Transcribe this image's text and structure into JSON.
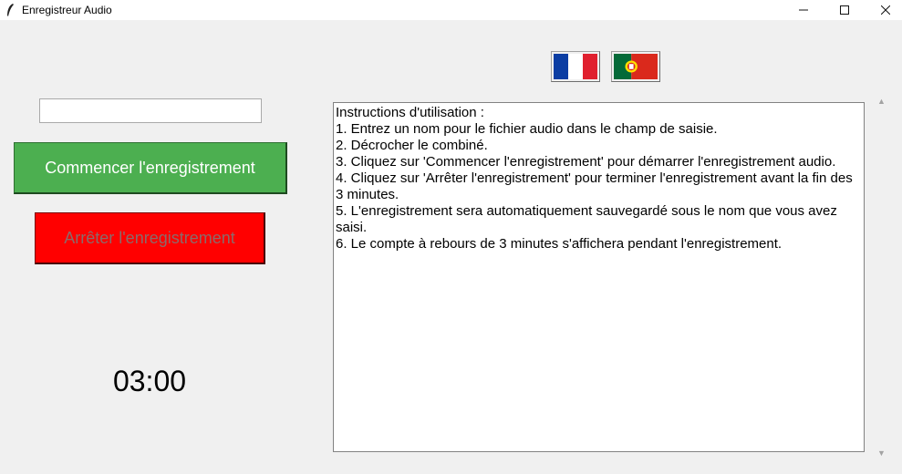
{
  "window": {
    "title": "Enregistreur Audio",
    "controls": {
      "minimize": "—",
      "maximize": "☐",
      "close": "✕"
    }
  },
  "languages": [
    {
      "name": "french-flag",
      "colors": [
        "#0b3da3",
        "#ffffff",
        "#e0202f"
      ]
    },
    {
      "name": "portugal-flag",
      "colors": [
        "#046a38",
        "#da291c",
        "#ffe100"
      ]
    }
  ],
  "form": {
    "filename_value": "",
    "filename_placeholder": ""
  },
  "buttons": {
    "start_label": "Commencer l'enregistrement",
    "stop_label": "Arrêter l'enregistrement"
  },
  "timer": "03:00",
  "instructions": [
    "Instructions d'utilisation :",
    "1. Entrez un nom pour le fichier audio dans le champ de saisie.",
    "2. Décrocher le combiné.",
    "3. Cliquez sur 'Commencer l'enregistrement' pour démarrer l'enregistrement audio.",
    "4. Cliquez sur 'Arrêter l'enregistrement' pour terminer l'enregistrement avant la fin des 3 minutes.",
    "5. L'enregistrement sera automatiquement sauvegardé sous le nom que vous avez saisi.",
    "6. Le compte à rebours de 3 minutes s'affichera pendant l'enregistrement."
  ],
  "colors": {
    "start_button": "#4caf50",
    "stop_button": "#ff0000",
    "stop_text": "#8b6a6a"
  },
  "scrollbar": {
    "up": "▲",
    "down": "▼"
  }
}
